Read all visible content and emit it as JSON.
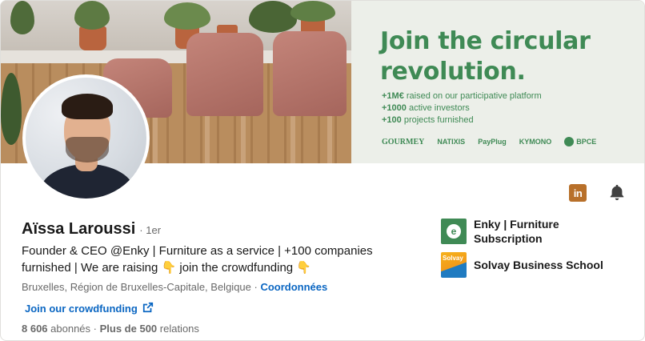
{
  "banner": {
    "headline": "Join the circular revolution.",
    "stats": [
      {
        "value": "+1M€",
        "text": " raised on our participative platform"
      },
      {
        "value": "+1000",
        "text": " active investors"
      },
      {
        "value": "+100",
        "text": " projects furnished"
      }
    ],
    "logos": [
      "GOURMEY",
      "NATIXIS",
      "PayPlug",
      "KYMONO",
      "BPCE"
    ],
    "accent_color": "#3f8a55"
  },
  "profile": {
    "name": "Aïssa Laroussi",
    "degree": "· 1er",
    "headline": "Founder & CEO @Enky | Furniture as a service | +100 companies furnished | We are raising 👇 join the crowdfunding 👇",
    "location": "Bruxelles, Région de Bruxelles-Capitale, Belgique",
    "location_separator": " · ",
    "contact_label": "Coordonnées",
    "website_label": "Join our crowdfunding",
    "followers": "8 606",
    "followers_label": " abonnés",
    "connections_separator": " · ",
    "connections": "Plus de 500",
    "connections_label": " relations"
  },
  "actions": {
    "linkedin_icon": "in",
    "bell_icon": "bell-icon"
  },
  "organizations": {
    "experience": {
      "name": "Enky | Furniture Subscription",
      "logo_letter": "e"
    },
    "education": {
      "name": "Solvay Business School",
      "logo_text": "Solvay"
    }
  },
  "colors": {
    "link": "#0a66c2",
    "linkedin_badge": "#b8702a"
  }
}
